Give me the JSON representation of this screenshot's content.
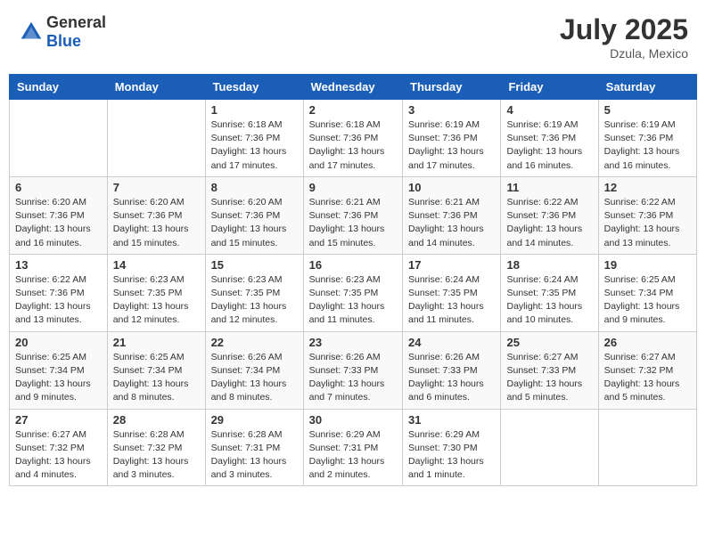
{
  "header": {
    "logo_general": "General",
    "logo_blue": "Blue",
    "month_year": "July 2025",
    "location": "Dzula, Mexico"
  },
  "days_of_week": [
    "Sunday",
    "Monday",
    "Tuesday",
    "Wednesday",
    "Thursday",
    "Friday",
    "Saturday"
  ],
  "weeks": [
    [
      {
        "day": "",
        "info": ""
      },
      {
        "day": "",
        "info": ""
      },
      {
        "day": "1",
        "info": "Sunrise: 6:18 AM\nSunset: 7:36 PM\nDaylight: 13 hours\nand 17 minutes."
      },
      {
        "day": "2",
        "info": "Sunrise: 6:18 AM\nSunset: 7:36 PM\nDaylight: 13 hours\nand 17 minutes."
      },
      {
        "day": "3",
        "info": "Sunrise: 6:19 AM\nSunset: 7:36 PM\nDaylight: 13 hours\nand 17 minutes."
      },
      {
        "day": "4",
        "info": "Sunrise: 6:19 AM\nSunset: 7:36 PM\nDaylight: 13 hours\nand 16 minutes."
      },
      {
        "day": "5",
        "info": "Sunrise: 6:19 AM\nSunset: 7:36 PM\nDaylight: 13 hours\nand 16 minutes."
      }
    ],
    [
      {
        "day": "6",
        "info": "Sunrise: 6:20 AM\nSunset: 7:36 PM\nDaylight: 13 hours\nand 16 minutes."
      },
      {
        "day": "7",
        "info": "Sunrise: 6:20 AM\nSunset: 7:36 PM\nDaylight: 13 hours\nand 15 minutes."
      },
      {
        "day": "8",
        "info": "Sunrise: 6:20 AM\nSunset: 7:36 PM\nDaylight: 13 hours\nand 15 minutes."
      },
      {
        "day": "9",
        "info": "Sunrise: 6:21 AM\nSunset: 7:36 PM\nDaylight: 13 hours\nand 15 minutes."
      },
      {
        "day": "10",
        "info": "Sunrise: 6:21 AM\nSunset: 7:36 PM\nDaylight: 13 hours\nand 14 minutes."
      },
      {
        "day": "11",
        "info": "Sunrise: 6:22 AM\nSunset: 7:36 PM\nDaylight: 13 hours\nand 14 minutes."
      },
      {
        "day": "12",
        "info": "Sunrise: 6:22 AM\nSunset: 7:36 PM\nDaylight: 13 hours\nand 13 minutes."
      }
    ],
    [
      {
        "day": "13",
        "info": "Sunrise: 6:22 AM\nSunset: 7:36 PM\nDaylight: 13 hours\nand 13 minutes."
      },
      {
        "day": "14",
        "info": "Sunrise: 6:23 AM\nSunset: 7:35 PM\nDaylight: 13 hours\nand 12 minutes."
      },
      {
        "day": "15",
        "info": "Sunrise: 6:23 AM\nSunset: 7:35 PM\nDaylight: 13 hours\nand 12 minutes."
      },
      {
        "day": "16",
        "info": "Sunrise: 6:23 AM\nSunset: 7:35 PM\nDaylight: 13 hours\nand 11 minutes."
      },
      {
        "day": "17",
        "info": "Sunrise: 6:24 AM\nSunset: 7:35 PM\nDaylight: 13 hours\nand 11 minutes."
      },
      {
        "day": "18",
        "info": "Sunrise: 6:24 AM\nSunset: 7:35 PM\nDaylight: 13 hours\nand 10 minutes."
      },
      {
        "day": "19",
        "info": "Sunrise: 6:25 AM\nSunset: 7:34 PM\nDaylight: 13 hours\nand 9 minutes."
      }
    ],
    [
      {
        "day": "20",
        "info": "Sunrise: 6:25 AM\nSunset: 7:34 PM\nDaylight: 13 hours\nand 9 minutes."
      },
      {
        "day": "21",
        "info": "Sunrise: 6:25 AM\nSunset: 7:34 PM\nDaylight: 13 hours\nand 8 minutes."
      },
      {
        "day": "22",
        "info": "Sunrise: 6:26 AM\nSunset: 7:34 PM\nDaylight: 13 hours\nand 8 minutes."
      },
      {
        "day": "23",
        "info": "Sunrise: 6:26 AM\nSunset: 7:33 PM\nDaylight: 13 hours\nand 7 minutes."
      },
      {
        "day": "24",
        "info": "Sunrise: 6:26 AM\nSunset: 7:33 PM\nDaylight: 13 hours\nand 6 minutes."
      },
      {
        "day": "25",
        "info": "Sunrise: 6:27 AM\nSunset: 7:33 PM\nDaylight: 13 hours\nand 5 minutes."
      },
      {
        "day": "26",
        "info": "Sunrise: 6:27 AM\nSunset: 7:32 PM\nDaylight: 13 hours\nand 5 minutes."
      }
    ],
    [
      {
        "day": "27",
        "info": "Sunrise: 6:27 AM\nSunset: 7:32 PM\nDaylight: 13 hours\nand 4 minutes."
      },
      {
        "day": "28",
        "info": "Sunrise: 6:28 AM\nSunset: 7:32 PM\nDaylight: 13 hours\nand 3 minutes."
      },
      {
        "day": "29",
        "info": "Sunrise: 6:28 AM\nSunset: 7:31 PM\nDaylight: 13 hours\nand 3 minutes."
      },
      {
        "day": "30",
        "info": "Sunrise: 6:29 AM\nSunset: 7:31 PM\nDaylight: 13 hours\nand 2 minutes."
      },
      {
        "day": "31",
        "info": "Sunrise: 6:29 AM\nSunset: 7:30 PM\nDaylight: 13 hours\nand 1 minute."
      },
      {
        "day": "",
        "info": ""
      },
      {
        "day": "",
        "info": ""
      }
    ]
  ]
}
